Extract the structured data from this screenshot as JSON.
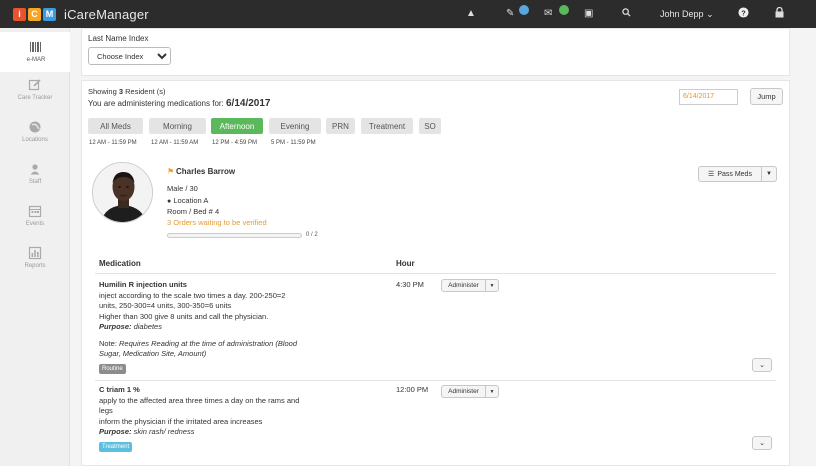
{
  "topbar": {
    "logo_letters": [
      "i",
      "C",
      "M"
    ],
    "logo_colors": [
      "#e8532d",
      "#f6a623",
      "#3e9bdb"
    ],
    "app_name": "iCareManager",
    "badge1": "",
    "badge2": "",
    "user_name": "John Depp"
  },
  "sidebar": {
    "items": [
      {
        "label": "e-MAR",
        "icon": "barcode-icon"
      },
      {
        "label": "Care Tracker",
        "icon": "edit-icon"
      },
      {
        "label": "Locations",
        "icon": "globe-icon"
      },
      {
        "label": "Staff",
        "icon": "users-icon"
      },
      {
        "label": "Events",
        "icon": "calendar-icon"
      },
      {
        "label": "Reports",
        "icon": "chart-icon"
      }
    ]
  },
  "filter": {
    "label": "Last Name Index",
    "select_value": "Choose Index"
  },
  "summary": {
    "showing_prefix": "Showing ",
    "count": "3",
    "showing_suffix": " Resident (s)",
    "admin_text": "You are administering medications for: ",
    "admin_date": "6/14/2017",
    "date_input": "6/14/2017",
    "jump": "Jump"
  },
  "tabs": [
    {
      "label": "All Meds",
      "range": "12 AM - 11:59 PM"
    },
    {
      "label": "Morning",
      "range": "12 AM - 11:59 AM"
    },
    {
      "label": "Afternoon",
      "range": "12 PM - 4:59 PM"
    },
    {
      "label": "Evening",
      "range": "5 PM - 11:59 PM"
    },
    {
      "label": "PRN",
      "range": ""
    },
    {
      "label": "Treatment",
      "range": ""
    },
    {
      "label": "SO",
      "range": ""
    }
  ],
  "resident": {
    "name": "Charles Barrow",
    "gender_age": "Male / 30",
    "location": "Location A",
    "room": "Room / Bed # 4",
    "orders": "3 Orders waiting to be verified",
    "progress": "0 / 2",
    "progress_fraction": 0,
    "pass_meds": "Pass Meds"
  },
  "table": {
    "col_medication": "Medication",
    "col_hour": "Hour"
  },
  "meds": [
    {
      "name": "Humilin R injection units",
      "lines": [
        "inject according to the scale two times a day. 200-250=2",
        "units, 250-300=4 units, 300-350=6 units",
        "Higher than 300 give 8 units and call the physician."
      ],
      "purpose_label": "Purpose:",
      "purpose": " diabetes",
      "note_prefix": "Note: ",
      "note_lines": [
        "Requires Reading at the time of administration (Blood",
        "Sugar, Medication Site, Amount)"
      ],
      "tag": "Routine",
      "hour": "4:30 PM",
      "action": "Administer"
    },
    {
      "name": "C triam 1 %",
      "lines": [
        "apply to the affected area three times a day on the rams and",
        "legs",
        "inform the physician if the irritated area increases"
      ],
      "purpose_label": "Purpose:",
      "purpose": " skin rash/ redness",
      "tag": "Treatment",
      "hour": "12:00 PM",
      "action": "Administer"
    }
  ]
}
